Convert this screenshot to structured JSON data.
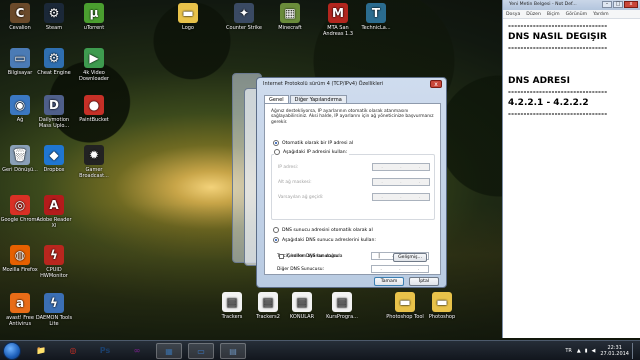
{
  "desktop": {
    "icons": [
      {
        "label": "Cevalion",
        "icon": "game-icon",
        "color": "#6b4a2a",
        "glyph": "C"
      },
      {
        "label": "Steam",
        "icon": "steam-icon",
        "color": "#1b2838",
        "glyph": "⚙"
      },
      {
        "label": "uTorrent",
        "icon": "utorrent-icon",
        "color": "#4a9e2f",
        "glyph": "µ"
      },
      {
        "label": "Logo",
        "icon": "folder-icon",
        "color": "#e8c24a",
        "glyph": "▬"
      },
      {
        "label": "Counter Strike",
        "icon": "cs-icon",
        "color": "#3a4a63",
        "glyph": "✦"
      },
      {
        "label": "Minecraft",
        "icon": "minecraft-icon",
        "color": "#6a8c3a",
        "glyph": "▦"
      },
      {
        "label": "MTA San Andreas 1.3",
        "icon": "mta-icon",
        "color": "#b3261e",
        "glyph": "M"
      },
      {
        "label": "TechnicLa...",
        "icon": "technic-icon",
        "color": "#2b6c8f",
        "glyph": "T"
      },
      {
        "label": "Bilgisayar",
        "icon": "computer-icon",
        "color": "#4b7bb5",
        "glyph": "▭"
      },
      {
        "label": "Cheat Engine",
        "icon": "cheat-engine-icon",
        "color": "#2f6fb0",
        "glyph": "⚙"
      },
      {
        "label": "4k Video Downloader",
        "icon": "4k-video-icon",
        "color": "#3e9b4f",
        "glyph": "▶"
      },
      {
        "label": "Ağ",
        "icon": "network-icon",
        "color": "#3b78c2",
        "glyph": "◉"
      },
      {
        "label": "Dailymotion Mass Uplo...",
        "icon": "dailymotion-icon",
        "color": "#4f5f8a",
        "glyph": "D"
      },
      {
        "label": "PaintBucket",
        "icon": "paint-icon",
        "color": "#c63027",
        "glyph": "●"
      },
      {
        "label": "Geri Dönüşü...",
        "icon": "recycle-bin-icon",
        "color": "#8aa0b8",
        "glyph": "🗑"
      },
      {
        "label": "Dropbox",
        "icon": "dropbox-icon",
        "color": "#1f76d1",
        "glyph": "◆"
      },
      {
        "label": "Gamer Broadcast...",
        "icon": "broadcast-icon",
        "color": "#222",
        "glyph": "✹"
      },
      {
        "label": "Google Chrome",
        "icon": "chrome-icon",
        "color": "#d93025",
        "glyph": "◎"
      },
      {
        "label": "Adobe Reader XI",
        "icon": "adobe-reader-icon",
        "color": "#b31b1b",
        "glyph": "A"
      },
      {
        "label": "Mozilla Firefox",
        "icon": "firefox-icon",
        "color": "#e66000",
        "glyph": "◍"
      },
      {
        "label": "CPUID HWMonitor",
        "icon": "hwmonitor-icon",
        "color": "#b9261e",
        "glyph": "ϟ"
      },
      {
        "label": "avast! Free Antivirus",
        "icon": "avast-icon",
        "color": "#e86c17",
        "glyph": "a"
      },
      {
        "label": "DAEMON Tools Lite",
        "icon": "daemon-tools-icon",
        "color": "#3b6fb4",
        "glyph": "ϟ"
      },
      {
        "label": "Trackers",
        "icon": "document-icon",
        "color": "#f2f2f2",
        "glyph": "▤"
      },
      {
        "label": "Trackers2",
        "icon": "document-icon",
        "color": "#f2f2f2",
        "glyph": "▤"
      },
      {
        "label": "KONULAR",
        "icon": "pdf-icon",
        "color": "#f2f2f2",
        "glyph": "▤"
      },
      {
        "label": "KursProgra...",
        "icon": "pdf-icon",
        "color": "#f2f2f2",
        "glyph": "▤"
      },
      {
        "label": "Photoshop Tool",
        "icon": "folder-icon",
        "color": "#e8c24a",
        "glyph": "▬"
      },
      {
        "label": "Photoshop",
        "icon": "folder-icon",
        "color": "#e8c24a",
        "glyph": "▬"
      }
    ]
  },
  "dialog": {
    "title": "Internet Protokolü sürüm 4 (TCP/IPv4) Özellikleri",
    "tabs": [
      "Genel",
      "Diğer Yapılandırma"
    ],
    "description": "Ağınız destekliyorsa, IP ayarlarının otomatik olarak atanmasını sağlayabilirsiniz. Aksi halde, IP ayarlarını için ağ yöneticinize başvurmanız gerekir.",
    "ip_auto": "Otomatik olarak bir IP adresi al",
    "ip_manual": "Aşağıdaki IP adresini kullan:",
    "ip_fields": [
      "IP adresi:",
      "Alt ağ maskesi:",
      "Varsayılan ağ geçidi:"
    ],
    "dns_auto": "DNS sunucu adresini otomatik olarak al",
    "dns_manual": "Aşağıdaki DNS sunucu adreslerini kullan:",
    "dns_fields": [
      "Tercih edilen DNS sunucusu:",
      "Diğer DNS Sunucusu:"
    ],
    "validate_label": "Çıkarken ayarları doğrula",
    "advanced_button": "Gelişmiş...",
    "ok_button": "Tamam",
    "cancel_button": "İptal",
    "close_glyph": "x"
  },
  "notepad": {
    "title": "Yeni Metin Belgesi - Not Def...",
    "menu": [
      "Dosya",
      "Düzen",
      "Biçim",
      "Görünüm",
      "Yardım"
    ],
    "lines": [
      {
        "type": "dash",
        "text": "--------------------------------"
      },
      {
        "type": "text",
        "text": "DNS NASIL DEĞİŞİR"
      },
      {
        "type": "dash",
        "text": "--------------------------------"
      },
      {
        "type": "blank",
        "text": ""
      },
      {
        "type": "blank",
        "text": ""
      },
      {
        "type": "text",
        "text": "DNS ADRESİ"
      },
      {
        "type": "dash",
        "text": "--------------------------------"
      },
      {
        "type": "text",
        "text": "4.2.2.1 - 4.2.2.2"
      },
      {
        "type": "dash",
        "text": "--------------------------------"
      }
    ]
  },
  "taskbar": {
    "apps": [
      {
        "name": "explorer",
        "glyph": "📁",
        "color": "#d9b44a"
      },
      {
        "name": "chrome",
        "glyph": "◎",
        "color": "#d93025"
      },
      {
        "name": "photoshop",
        "glyph": "Ps",
        "color": "#1b3f6b"
      },
      {
        "name": "visual-studio",
        "glyph": "∞",
        "color": "#68217a"
      },
      {
        "name": "user-folder",
        "glyph": "▦",
        "color": "#3a6ea5"
      },
      {
        "name": "network-window",
        "glyph": "▭",
        "color": "#3b78c2"
      },
      {
        "name": "notepad",
        "glyph": "▤",
        "color": "#6b8fb8"
      }
    ],
    "language": "TR",
    "time": "22:31",
    "date": "27.01.2014"
  }
}
